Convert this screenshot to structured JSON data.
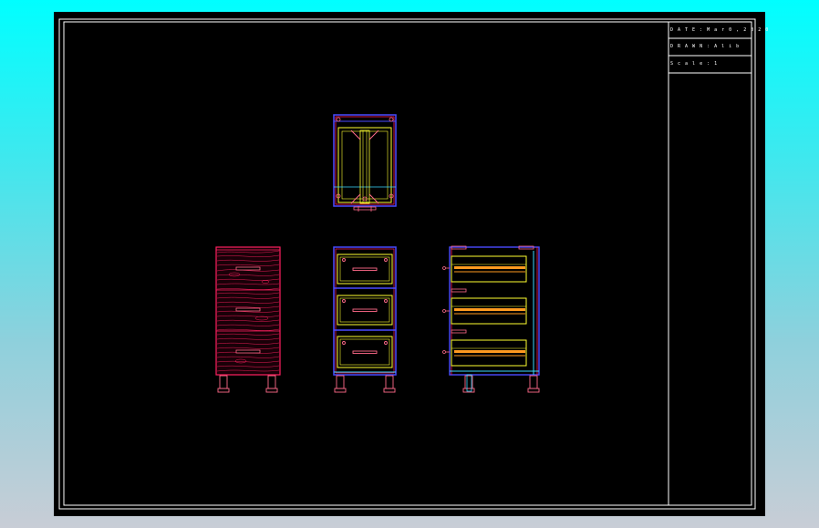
{
  "title_block": {
    "date_line": "D A T E : M a r   0 , 2 0 2 0",
    "drawn_line": "D R A W N   : A l i b",
    "scale_line": "S c a l e : 1"
  },
  "colors": {
    "background": "#000000",
    "frame": "#ffffff",
    "panel_red": "#ff2060",
    "carcass_blue": "#4a4aff",
    "drawer_yellow": "#ffff30",
    "runner_orange": "#ff9a20",
    "fitting_pink": "#ff6a8a",
    "edge_cyan": "#3ad8ff"
  },
  "views": [
    "plan-view",
    "front-view-textured",
    "front-view-internal",
    "side-section-view"
  ]
}
